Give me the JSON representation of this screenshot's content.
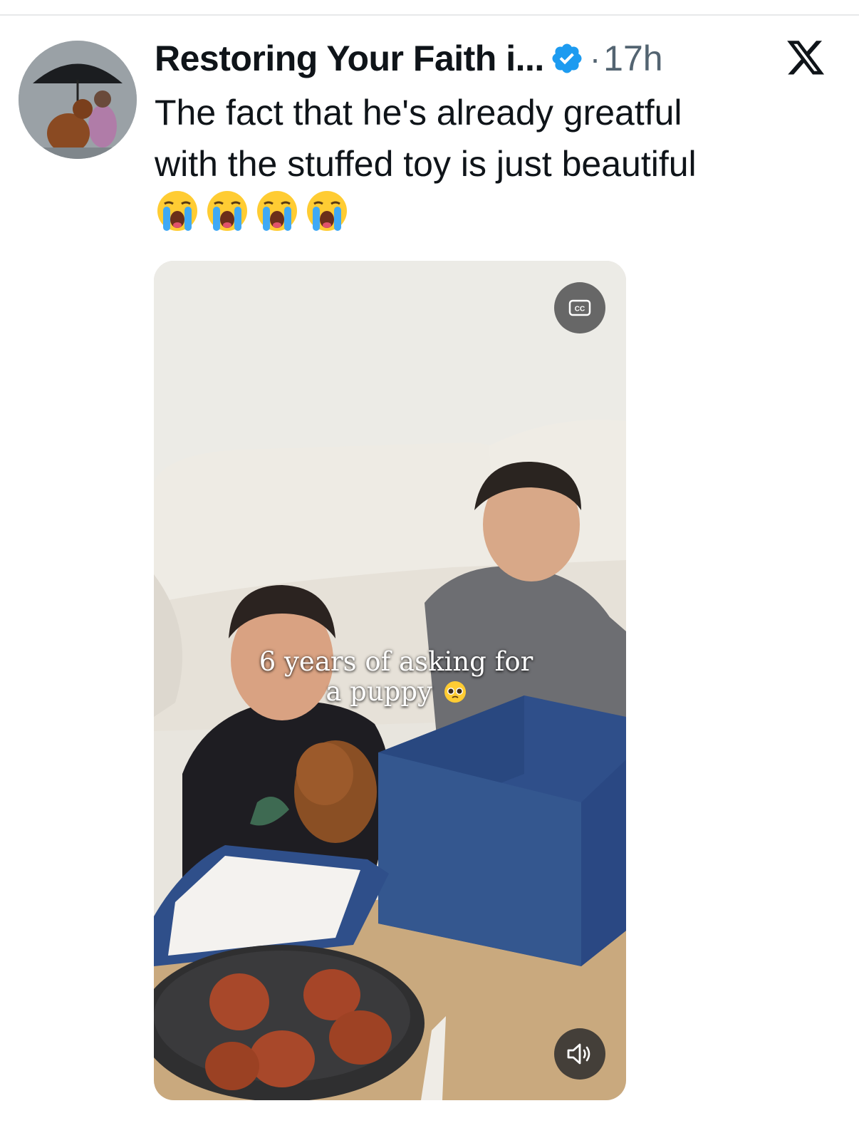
{
  "tweet": {
    "author": {
      "display_name": "Restoring Your Faith i...",
      "verified": true
    },
    "separator": "·",
    "timestamp": "17h",
    "text_lines": [
      "The fact that he's already greatful",
      "with the stuffed toy is just beautiful"
    ],
    "emojis": [
      "loudly-crying-face",
      "loudly-crying-face",
      "loudly-crying-face",
      "loudly-crying-face"
    ]
  },
  "media": {
    "type": "video",
    "caption_lines": [
      "6 years of asking for",
      "a puppy"
    ],
    "caption_emoji": "pleading-face",
    "controls": {
      "captions_icon": "closed-captions-icon",
      "volume_icon": "speaker-volume-icon"
    }
  },
  "platform_logo": "x-logo",
  "colors": {
    "text_primary": "#0f1419",
    "text_secondary": "#536471",
    "verified_blue": "#1d9bf0",
    "box_blue": "#2f4f8a"
  }
}
